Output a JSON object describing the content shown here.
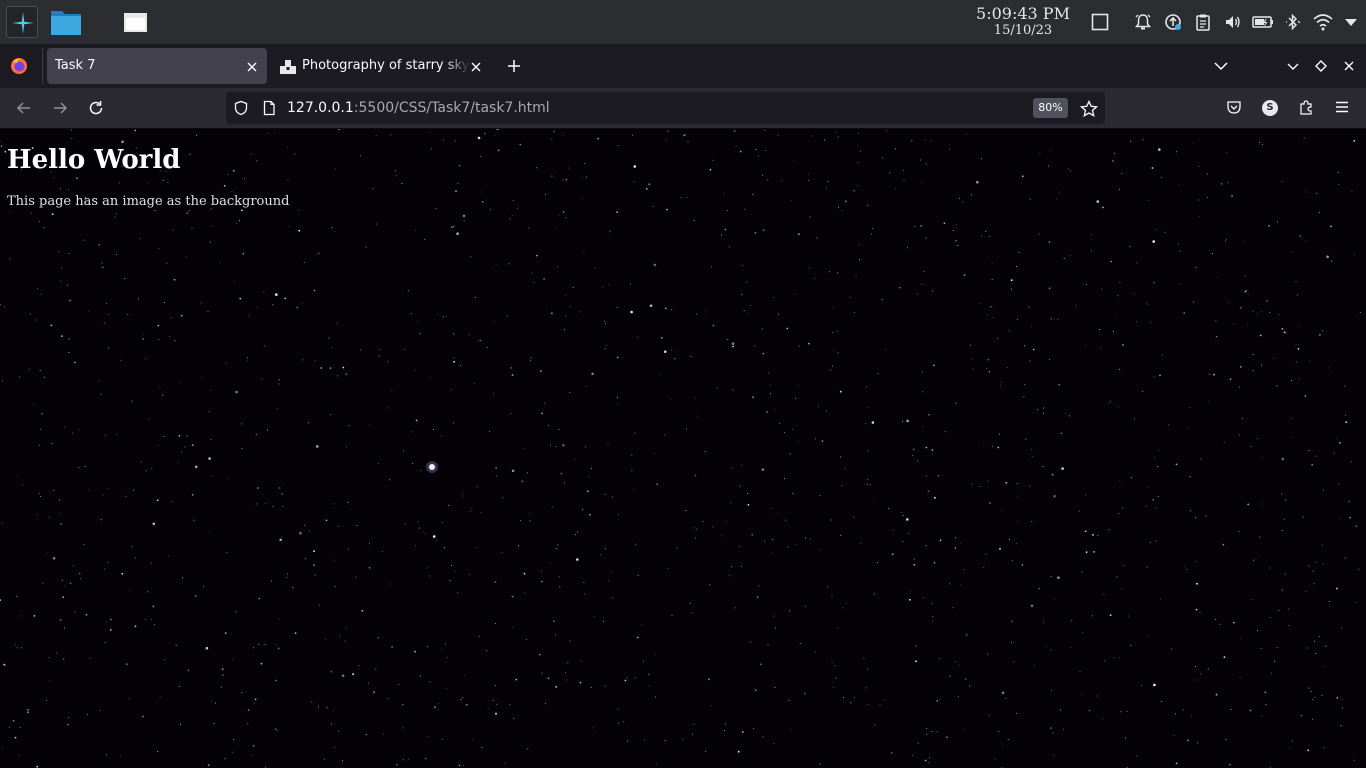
{
  "system_panel": {
    "time": "5:09:43 PM",
    "date": "15/10/23",
    "tray_icons": [
      "show-desktop-icon",
      "notifications-icon",
      "updates-icon",
      "clipboard-icon",
      "volume-icon",
      "battery-icon",
      "bluetooth-icon",
      "wifi-icon",
      "panel-menu-icon"
    ],
    "taskbar_items": [
      "app-launcher-icon",
      "file-manager-icon",
      "window-icon"
    ]
  },
  "browser": {
    "tabs": [
      {
        "title": "Task 7",
        "active": true
      },
      {
        "title": "Photography of starry sky",
        "active": false
      }
    ],
    "url": {
      "host": "127.0.0.1",
      "path": ":5500/CSS/Task7/task7.html"
    },
    "zoom": "80%",
    "account_initial": "S"
  },
  "page": {
    "heading": "Hello World",
    "text": "This page has an image as the background"
  },
  "colors": {
    "panel": "#2b2d31",
    "tabstrip": "#1c1b22",
    "active_tab": "#42414d",
    "toolbar": "#2b2a33",
    "page_background": "#040206"
  }
}
